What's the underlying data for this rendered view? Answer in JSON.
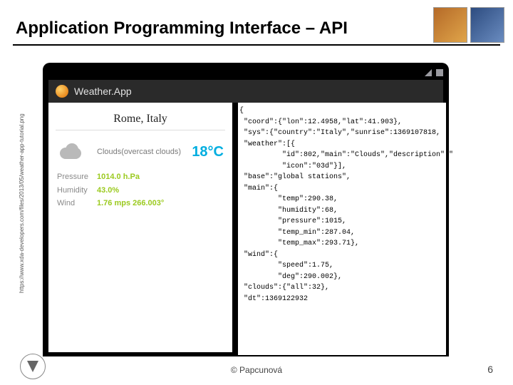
{
  "title": "Application Programming Interface – API",
  "source_text": "https://www.xda-developers.com/files/2013/05/weather-app-tutorial.png",
  "app": {
    "name": "Weather.App",
    "location": "Rome, Italy",
    "condition": "Clouds(overcast clouds)",
    "temperature": "18°C",
    "metrics": {
      "pressure_label": "Pressure",
      "pressure_value": "1014.0 h.Pa",
      "humidity_label": "Humidity",
      "humidity_value": "43.0%",
      "wind_label": "Wind",
      "wind_value": "1.76 mps 266.003°"
    }
  },
  "json_text": "{\n \"coord\":{\"lon\":12.4958,\"lat\":41.903},\n \"sys\":{\"country\":\"Italy\",\"sunrise\":1369107818,\n \"weather\":[{\n          \"id\":802,\"main\":\"Clouds\",\"description\":\"\n          \"icon\":\"03d\"}],\n \"base\":\"global stations\",\n \"main\":{\n         \"temp\":290.38,\n         \"humidity\":68,\n         \"pressure\":1015,\n         \"temp_min\":287.04,\n         \"temp_max\":293.71},\n \"wind\":{\n         \"speed\":1.75,\n         \"deg\":290.002},\n \"clouds\":{\"all\":32},\n \"dt\":1369122932",
  "footer": {
    "author": "© Papcunová",
    "page": "6"
  }
}
